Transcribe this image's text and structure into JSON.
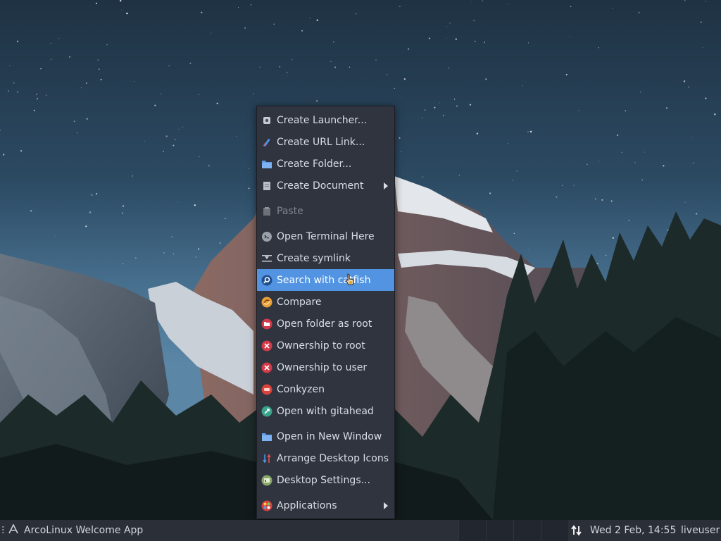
{
  "desktop": {
    "wallpaper": "night-sky-mountain"
  },
  "context_menu": {
    "items": [
      {
        "label": "Create Launcher...",
        "icon": "gear-icon"
      },
      {
        "label": "Create URL Link...",
        "icon": "link-icon"
      },
      {
        "label": "Create Folder...",
        "icon": "folder-icon"
      },
      {
        "label": "Create Document",
        "icon": "document-icon",
        "submenu": true
      },
      {
        "label": "Paste",
        "icon": "paste-icon",
        "disabled": true
      },
      {
        "label": "Open Terminal Here",
        "icon": "terminal-icon"
      },
      {
        "label": "Create symlink",
        "icon": "symlink-icon"
      },
      {
        "label": "Search with catfish",
        "icon": "search-icon",
        "highlighted": true
      },
      {
        "label": "Compare",
        "icon": "compare-icon"
      },
      {
        "label": "Open folder as root",
        "icon": "root-folder-icon"
      },
      {
        "label": "Ownership to root",
        "icon": "ownership-root-icon"
      },
      {
        "label": "Ownership to user",
        "icon": "ownership-user-icon"
      },
      {
        "label": "Conkyzen",
        "icon": "conkyzen-icon"
      },
      {
        "label": "Open with gitahead",
        "icon": "gitahead-icon"
      },
      {
        "label": "Open in New Window",
        "icon": "folder-icon"
      },
      {
        "label": "Arrange Desktop Icons",
        "icon": "arrange-icon"
      },
      {
        "label": "Desktop Settings...",
        "icon": "desktop-settings-icon"
      },
      {
        "label": "Applications",
        "icon": "applications-icon",
        "submenu": true
      }
    ]
  },
  "taskbar": {
    "task_label": "ArcoLinux Welcome App",
    "clock": "Wed  2 Feb, 14:55",
    "user": "liveuser"
  },
  "colors": {
    "menu_bg": "#2f343f",
    "highlight": "#5294e2",
    "taskbar_bg": "#2b2f38"
  }
}
